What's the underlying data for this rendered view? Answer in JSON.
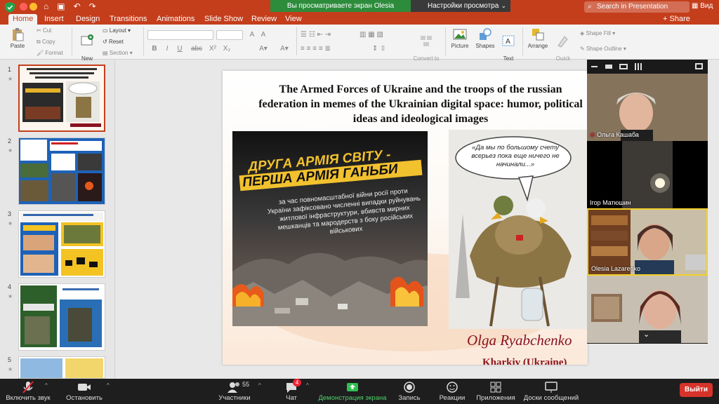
{
  "titlebar": {
    "share_banner": "Вы просматриваете экран Olesia Lazarenko",
    "view_settings": "Настройки просмотра",
    "search_placeholder": "Search in Presentation",
    "view_label": "Вид",
    "accent": "#c43e1c"
  },
  "tabs": [
    "Home",
    "Insert",
    "Design",
    "Transitions",
    "Animations",
    "Slide Show",
    "Review",
    "View"
  ],
  "share_label": "Share",
  "ribbon": {
    "paste": "Paste",
    "cut": "Cut",
    "copy": "Copy",
    "format": "Format",
    "new_slide": "New\nSlide",
    "layout": "Layout",
    "reset": "Reset",
    "section": "Section",
    "convert": "Convert to\nSmartArt",
    "picture": "Picture",
    "shapes": "Shapes",
    "textbox": "Text\nBox",
    "arrange": "Arrange",
    "quick_styles": "Quick\nStyles",
    "shape_fill": "Shape Fill",
    "shape_outline": "Shape Outline",
    "bold": "B",
    "italic": "I",
    "underline": "U",
    "strike": "abc",
    "superscript": "X²",
    "subscript": "X₂"
  },
  "thumbnails": [
    {
      "num": "1",
      "star": "★"
    },
    {
      "num": "2",
      "star": "★"
    },
    {
      "num": "3",
      "star": "★"
    },
    {
      "num": "4",
      "star": "★"
    },
    {
      "num": "5",
      "star": "★"
    }
  ],
  "slide": {
    "title": "The Armed Forces of Ukraine and the troops of the russian federation in memes of the Ukrainian digital space: humor, political ideas and ideological images",
    "meme_left_heading_1": "ДРУГА АРМІЯ СВІТУ -",
    "meme_left_heading_2": "ПЕРША АРМІЯ ГАНЬБИ",
    "meme_left_body": "за час повномасштабної війни росії проти України зафіксовано численні випадки руйнувань житлової інфраструктури, вбивств мирних мешканців та мародерств з боку російських військових",
    "meme_right_bubble": "«Да мы по большому счету всерьез пока еще ничего не начинали...»",
    "author": "Olga Ryabchenko",
    "city": "Kharkiv (Ukraine)"
  },
  "participants": [
    {
      "name": "Ольга Кашаба",
      "muted": true
    },
    {
      "name": "Ігор Матюшин",
      "muted": false
    },
    {
      "name": "Olesia Lazarenko",
      "muted": false
    },
    {
      "name": "",
      "muted": false
    }
  ],
  "zoom_bar": {
    "mute": "Включить звук",
    "video": "Остановить видео",
    "participants": "Участники",
    "participants_count": "55",
    "chat": "Чат",
    "chat_badge": "4",
    "share": "Демонстрация экрана",
    "record": "Запись",
    "reactions": "Реакции",
    "apps": "Приложения",
    "boards": "Доски сообщений",
    "leave": "Выйти"
  }
}
